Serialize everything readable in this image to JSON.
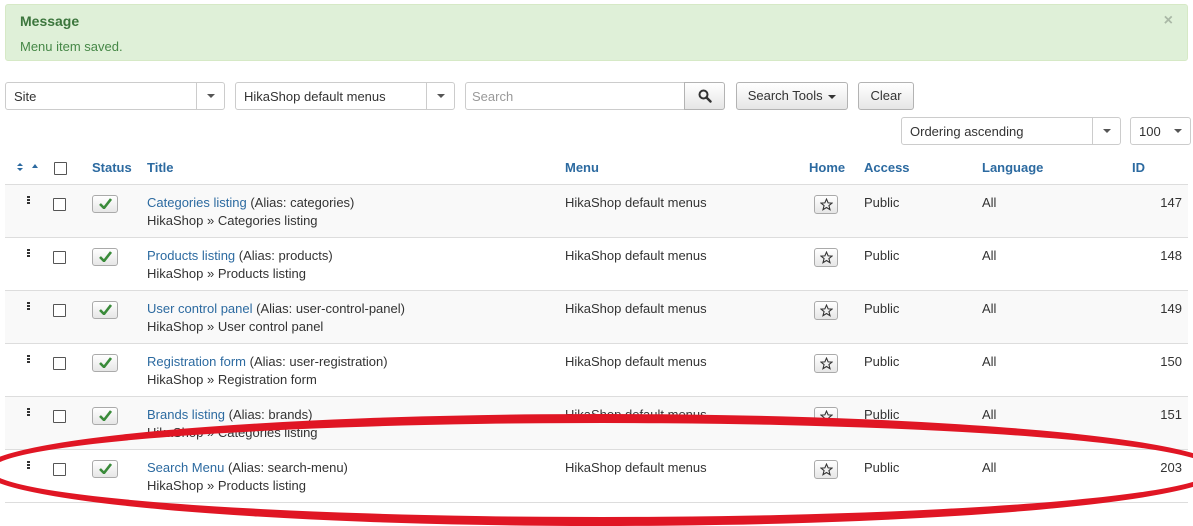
{
  "alert": {
    "heading": "Message",
    "text": "Menu item saved.",
    "close": "×"
  },
  "filters": {
    "client": "Site",
    "menu": "HikaShop default menus",
    "search_placeholder": "Search",
    "search_tools": "Search Tools",
    "clear": "Clear",
    "ordering": "Ordering ascending",
    "limit": "100"
  },
  "table": {
    "headers": {
      "status": "Status",
      "title": "Title",
      "menu": "Menu",
      "home": "Home",
      "access": "Access",
      "language": "Language",
      "id": "ID"
    },
    "rows": [
      {
        "title": "Categories listing",
        "alias": "(Alias: categories)",
        "path": "HikaShop » Categories listing",
        "menu": "HikaShop default menus",
        "access": "Public",
        "language": "All",
        "id": "147"
      },
      {
        "title": "Products listing",
        "alias": "(Alias: products)",
        "path": "HikaShop » Products listing",
        "menu": "HikaShop default menus",
        "access": "Public",
        "language": "All",
        "id": "148"
      },
      {
        "title": "User control panel",
        "alias": "(Alias: user-control-panel)",
        "path": "HikaShop » User control panel",
        "menu": "HikaShop default menus",
        "access": "Public",
        "language": "All",
        "id": "149"
      },
      {
        "title": "Registration form",
        "alias": "(Alias: user-registration)",
        "path": "HikaShop » Registration form",
        "menu": "HikaShop default menus",
        "access": "Public",
        "language": "All",
        "id": "150"
      },
      {
        "title": "Brands listing",
        "alias": "(Alias: brands)",
        "path": "HikaShop » Categories listing",
        "menu": "HikaShop default menus",
        "access": "Public",
        "language": "All",
        "id": "151"
      },
      {
        "title": "Search Menu",
        "alias": "(Alias: search-menu)",
        "path": "HikaShop » Products listing",
        "menu": "HikaShop default menus",
        "access": "Public",
        "language": "All",
        "id": "203"
      }
    ]
  },
  "colors": {
    "link": "#2c6aa0",
    "success_bg": "#dff0d8",
    "annotation": "#e01624"
  }
}
